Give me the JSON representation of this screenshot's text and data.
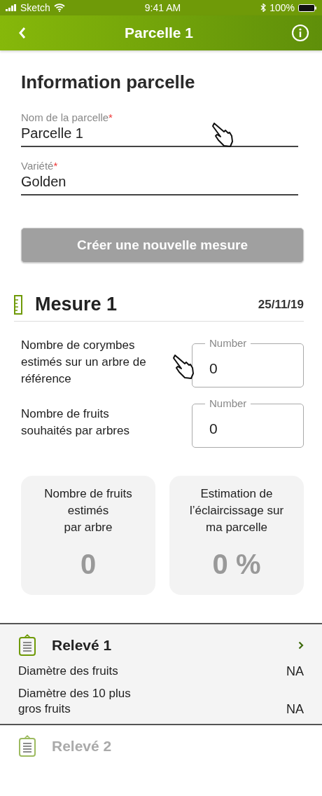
{
  "status_bar": {
    "carrier": "Sketch",
    "time": "9:41 AM",
    "battery": "100%"
  },
  "nav_bar": {
    "title": "Parcelle 1"
  },
  "section_title": "Information parcelle",
  "fields": [
    {
      "label": "Nom de la parcelle",
      "required_mark": "*",
      "value": "Parcelle 1"
    },
    {
      "label": "Variété",
      "required_mark": "*",
      "value": "Golden"
    }
  ],
  "create_button": {
    "label": "Créer une nouvelle mesure",
    "disabled": true
  },
  "measure": {
    "title": "Mesure 1",
    "date": "25/11/19",
    "inputs": [
      {
        "label": "Nombre de corymbes estimés sur un arbre de référence",
        "placeholder": "Number",
        "value": "0"
      },
      {
        "label": "Nombre de fruits souhaités par arbres",
        "placeholder": "Number",
        "value": "0"
      }
    ],
    "results": [
      {
        "label": "Nombre de fruits estimés\npar arbre",
        "value": "0"
      },
      {
        "label": "Estimation de l’éclaircissage sur ma parcelle",
        "value": "0 %"
      }
    ]
  },
  "releves": [
    {
      "title": "Relevé 1",
      "expanded": true,
      "rows": [
        {
          "label": "Diamètre des fruits",
          "value": "NA"
        },
        {
          "label": "Diamètre des 10 plus gros fruits",
          "value": "NA"
        }
      ]
    },
    {
      "title": "Relevé 2",
      "expanded": false
    }
  ]
}
